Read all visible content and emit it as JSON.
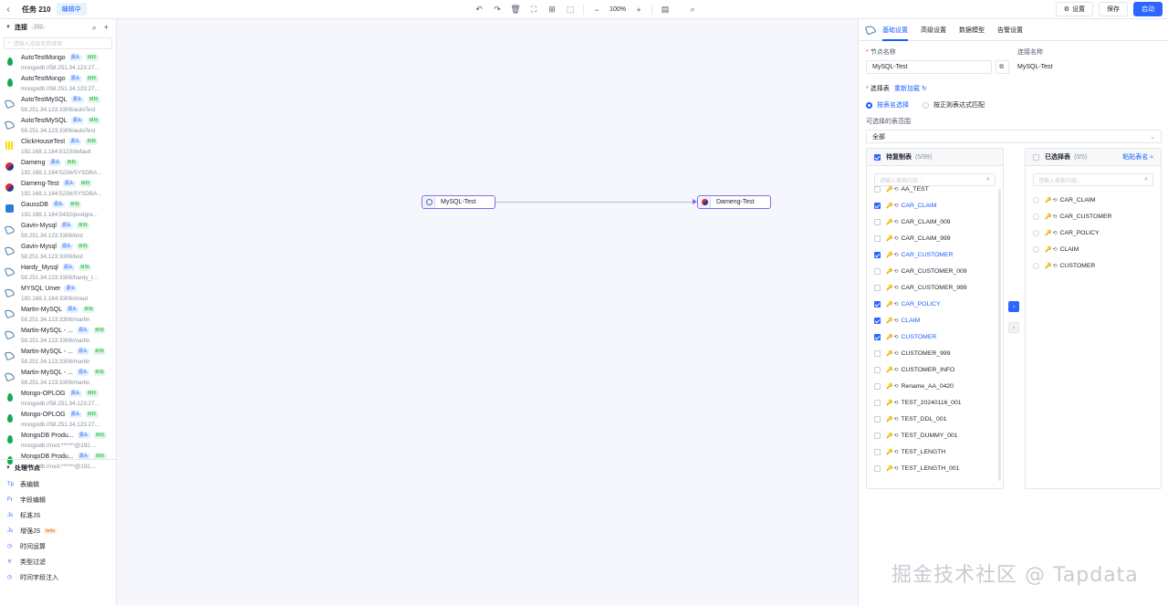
{
  "header": {
    "task_title": "任务 210",
    "status_badge": "编辑中",
    "zoom": "100%",
    "settings_label": "设置",
    "save_label": "保存",
    "start_label": "启动"
  },
  "sidebar": {
    "connections_title": "连接",
    "connections_count": "232",
    "search_placeholder": "请输入连接名称搜索",
    "source_tag": "源头",
    "target_tag": "目标",
    "connections": [
      {
        "name": "AutoTestMongo",
        "sub": "mongodb://58.251.34.123:27...",
        "icon": "mongo",
        "tags": [
          "源头",
          "目标"
        ]
      },
      {
        "name": "AutoTestMongo",
        "sub": "mongodb://58.251.34.123:27...",
        "icon": "mongo",
        "tags": [
          "源头",
          "目标"
        ]
      },
      {
        "name": "AutoTestMySQL",
        "sub": "58.251.34.123:3306/autoTest",
        "icon": "mysql",
        "tags": [
          "源头",
          "目标"
        ]
      },
      {
        "name": "AutoTestMySQL",
        "sub": "58.251.34.123:3306/autoTest",
        "icon": "mysql",
        "tags": [
          "源头",
          "目标"
        ]
      },
      {
        "name": "ClickHouseTest",
        "sub": "192.168.1.184:8123/default",
        "icon": "ch",
        "tags": [
          "源头",
          "目标"
        ]
      },
      {
        "name": "Dameng",
        "sub": "192.168.1.184:5236/SYSDBA...",
        "icon": "dm",
        "tags": [
          "源头",
          "目标"
        ]
      },
      {
        "name": "Dameng-Test",
        "sub": "192.168.1.184:5236/SYSDBA...",
        "icon": "dm",
        "tags": [
          "源头",
          "目标"
        ]
      },
      {
        "name": "GaussDB",
        "sub": "192.168.1.184:5432/postgre...",
        "icon": "gauss",
        "tags": [
          "源头",
          "目标"
        ]
      },
      {
        "name": "Gavin-Mysql",
        "sub": "58.251.34.123:3306/test",
        "icon": "mysql",
        "tags": [
          "源头",
          "目标"
        ]
      },
      {
        "name": "Gavin-Mysql",
        "sub": "58.251.34.123:3306/test",
        "icon": "mysql",
        "tags": [
          "源头",
          "目标"
        ]
      },
      {
        "name": "Hardy_Mysql",
        "sub": "58.251.34.123:3306/hardy_t...",
        "icon": "mysql",
        "tags": [
          "源头",
          "目标"
        ]
      },
      {
        "name": "MYSQL Umer",
        "sub": "192.168.1.184:3306/cloud",
        "icon": "mysql",
        "tags": [
          "源头"
        ]
      },
      {
        "name": "Martin-MySQL",
        "sub": "58.251.34.123:3306/martin",
        "icon": "mysql",
        "tags": [
          "源头",
          "目标"
        ]
      },
      {
        "name": "Martin-MySQL - ...",
        "sub": "58.251.34.123:3306/martin",
        "icon": "mysql",
        "tags": [
          "源头",
          "目标"
        ]
      },
      {
        "name": "Martin-MySQL - ...",
        "sub": "58.251.34.123:3306/martin",
        "icon": "mysql",
        "tags": [
          "源头",
          "目标"
        ]
      },
      {
        "name": "Martin-MySQL - ...",
        "sub": "58.251.34.123:3306/martin",
        "icon": "mysql",
        "tags": [
          "源头",
          "目标"
        ]
      },
      {
        "name": "Mongo-OPLOG",
        "sub": "mongodb://58.251.34.123:27...",
        "icon": "mongo",
        "tags": [
          "源头",
          "目标"
        ]
      },
      {
        "name": "Mongo-OPLOG",
        "sub": "mongodb://58.251.34.123:27...",
        "icon": "mongo",
        "tags": [
          "源头",
          "目标"
        ]
      },
      {
        "name": "MongoDB Produ...",
        "sub": "mongodb://root:******@192....",
        "icon": "mongo",
        "tags": [
          "源头",
          "目标"
        ]
      },
      {
        "name": "MongoDB Produ...",
        "sub": "mongodb://root:******@192....",
        "icon": "mongo",
        "tags": [
          "源头",
          "目标"
        ]
      }
    ],
    "process_title": "处理节点",
    "process_items": [
      {
        "icon": "Tp",
        "label": "表编辑",
        "beta": ""
      },
      {
        "icon": "Fr",
        "label": "字段编辑",
        "beta": ""
      },
      {
        "icon": "Js",
        "label": "标准JS",
        "beta": ""
      },
      {
        "icon": "Js",
        "label": "增强JS",
        "beta": "beta"
      },
      {
        "icon": "◷",
        "label": "时间运算",
        "beta": ""
      },
      {
        "icon": "⚟",
        "label": "类型过滤",
        "beta": ""
      },
      {
        "icon": "◷",
        "label": "时间字段注入",
        "beta": ""
      }
    ]
  },
  "canvas": {
    "source_node": "MySQL-Test",
    "target_node": "Dameng-Test",
    "watermark": "掘金技术社区 @ Tapdata"
  },
  "panel": {
    "tabs": [
      "基础设置",
      "高级设置",
      "数据模型",
      "告警设置"
    ],
    "node_name_label": "节点名称",
    "node_name_value": "MySQL-Test",
    "conn_name_label": "连接名称",
    "conn_name_value": "MySQL-Test",
    "select_table_label": "选择表",
    "reload_label": "重新加载",
    "radio_by_name": "按表名选择",
    "radio_by_regex": "按正则表达式匹配",
    "range_label": "可选择的表范围",
    "range_value": "全部",
    "left_box_title": "待复制表",
    "left_box_count": "(5/99)",
    "right_box_title": "已选择表",
    "right_box_count": "(0/5)",
    "paste_label": "粘贴表名",
    "search_placeholder": "请输入搜索内容...",
    "left_tables": [
      {
        "name": "AA_TEST",
        "checked": false
      },
      {
        "name": "CAR_CLAIM",
        "checked": true
      },
      {
        "name": "CAR_CLAIM_009",
        "checked": false
      },
      {
        "name": "CAR_CLAIM_999",
        "checked": false
      },
      {
        "name": "CAR_CUSTOMER",
        "checked": true
      },
      {
        "name": "CAR_CUSTOMER_009",
        "checked": false
      },
      {
        "name": "CAR_CUSTOMER_999",
        "checked": false
      },
      {
        "name": "CAR_POLICY",
        "checked": true
      },
      {
        "name": "CLAIM",
        "checked": true
      },
      {
        "name": "CUSTOMER",
        "checked": true
      },
      {
        "name": "CUSTOMER_999",
        "checked": false
      },
      {
        "name": "CUSTOMER_INFO",
        "checked": false
      },
      {
        "name": "Rename_AA_0420",
        "checked": false
      },
      {
        "name": "TEST_20240116_001",
        "checked": false
      },
      {
        "name": "TEST_DDL_001",
        "checked": false
      },
      {
        "name": "TEST_DUMMY_001",
        "checked": false
      },
      {
        "name": "TEST_LENGTH",
        "checked": false
      },
      {
        "name": "TEST_LENGTH_001",
        "checked": false
      }
    ],
    "right_tables": [
      "CAR_CLAIM",
      "CAR_CUSTOMER",
      "CAR_POLICY",
      "CLAIM",
      "CUSTOMER"
    ]
  },
  "colors": {
    "accent": "#165dff",
    "primary_button": "#2c65ff",
    "node_border": "#7f6ee8"
  }
}
